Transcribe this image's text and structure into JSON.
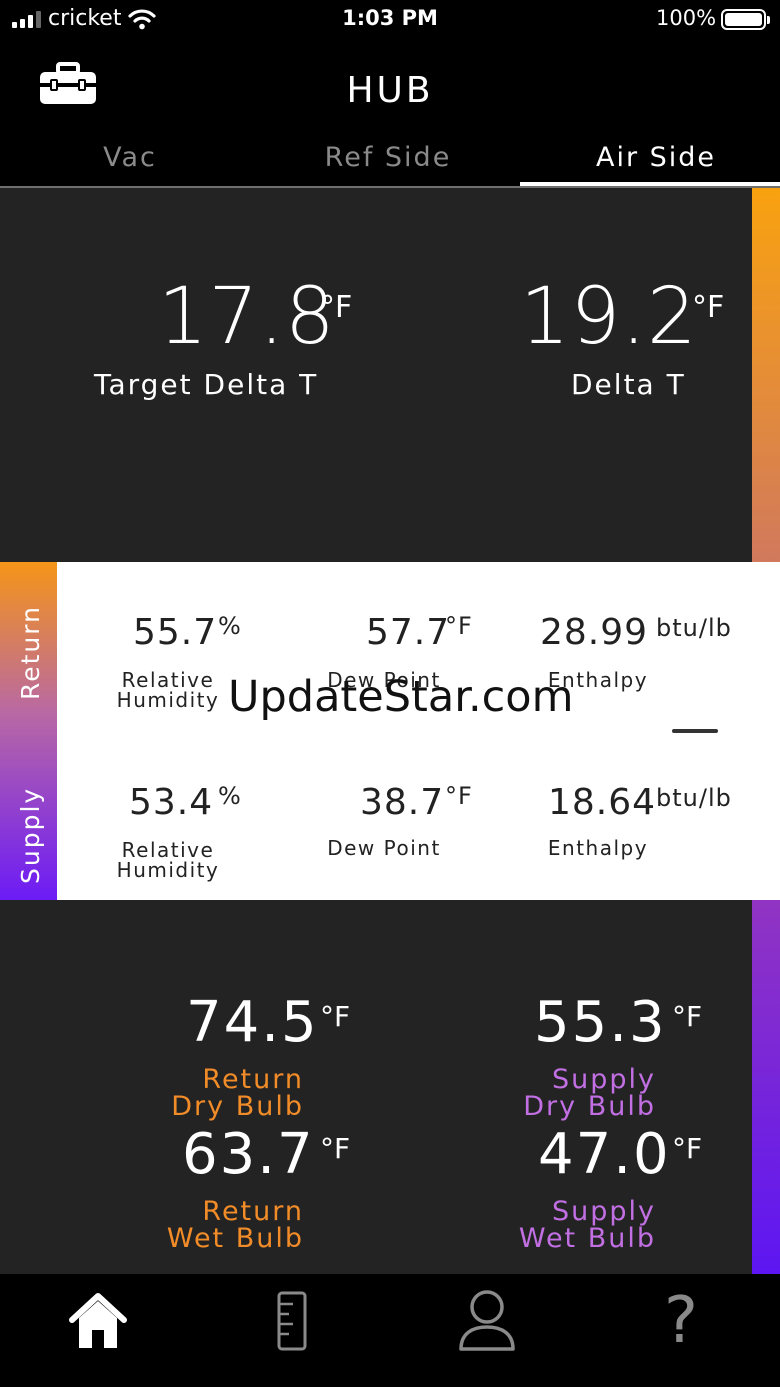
{
  "status_bar": {
    "carrier": "cricket",
    "time": "1:03 PM",
    "battery": "100%"
  },
  "header": {
    "title": "HUB",
    "toolbox_icon": "toolbox-icon"
  },
  "tabs": [
    {
      "label": "Vac",
      "active": false
    },
    {
      "label": "Ref Side",
      "active": false
    },
    {
      "label": "Air Side",
      "active": true
    }
  ],
  "delta": {
    "target_value": "17.8",
    "target_unit": "°F",
    "target_label": "Target Delta T",
    "actual_value": "19.2",
    "actual_unit": "°F",
    "actual_label": "Delta T"
  },
  "humidity_panel": {
    "return_label": "Return",
    "supply_label": "Supply",
    "return": {
      "rh_value": "55.7",
      "rh_unit": "%",
      "rh_label_1": "Relative",
      "rh_label_2": "Humidity",
      "dew_value": "57.7",
      "dew_unit": "°F",
      "dew_label": "Dew Point",
      "enthalpy_value": "28.99",
      "enthalpy_unit": "btu/lb",
      "enthalpy_label": "Enthalpy"
    },
    "supply": {
      "rh_value": "53.4",
      "rh_unit": "%",
      "rh_label_1": "Relative",
      "rh_label_2": "Humidity",
      "dew_value": "38.7",
      "dew_unit": "°F",
      "dew_label": "Dew Point",
      "enthalpy_value": "18.64",
      "enthalpy_unit": "btu/lb",
      "enthalpy_label": "Enthalpy"
    },
    "watermark": "UpdateStar.com"
  },
  "bulbs": {
    "return_dry_value": "74.5",
    "return_dry_unit": "°F",
    "return_dry_label_1": "Return",
    "return_dry_label_2": "Dry Bulb",
    "supply_dry_value": "55.3",
    "supply_dry_unit": "°F",
    "supply_dry_label_1": "Supply",
    "supply_dry_label_2": "Dry Bulb",
    "return_wet_value": "63.7",
    "return_wet_unit": "°F",
    "return_wet_label_1": "Return",
    "return_wet_label_2": "Wet Bulb",
    "supply_wet_value": "47.0",
    "supply_wet_unit": "°F",
    "supply_wet_label_1": "Supply",
    "supply_wet_label_2": "Wet Bulb"
  },
  "nav": {
    "items": [
      "home-icon",
      "ruler-icon",
      "profile-icon",
      "help-icon"
    ],
    "help_glyph": "?"
  },
  "colors": {
    "return_accent": "#f28c28",
    "supply_accent": "#c16fe3",
    "panel_bg": "#232323"
  }
}
